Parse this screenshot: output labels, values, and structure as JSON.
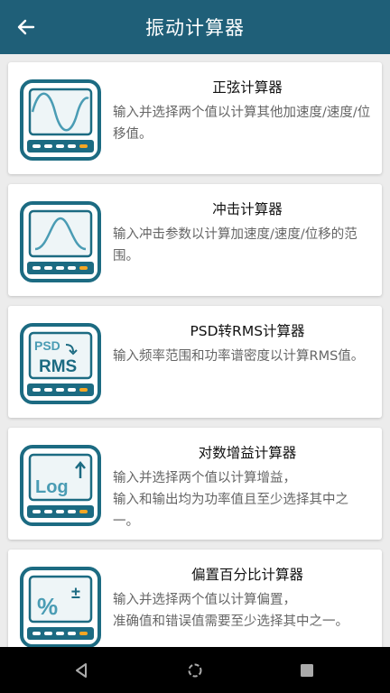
{
  "header": {
    "title": "振动计算器",
    "back_icon": "arrow-left-icon"
  },
  "colors": {
    "appbar": "#1f5f78",
    "accent": "#1c6b82",
    "orange": "#f5a623",
    "background": "#ececec"
  },
  "cards": [
    {
      "title": "正弦计算器",
      "desc": "输入并选择两个值以计算其他加速度/速度/位移值。",
      "icon": "sine-wave-calculator-icon"
    },
    {
      "title": "冲击计算器",
      "desc": "输入冲击参数以计算加速度/速度/位移的范围。",
      "icon": "shock-pulse-calculator-icon"
    },
    {
      "title": "PSD转RMS计算器",
      "desc": "输入频率范围和功率谱密度以计算RMS值。",
      "icon": "psd-rms-calculator-icon",
      "icon_text_1": "PSD",
      "icon_text_2": "RMS"
    },
    {
      "title": "对数增益计算器",
      "desc": "输入并选择两个值以计算增益，\n输入和输出均为功率值且至少选择其中之一。",
      "icon": "log-gain-calculator-icon",
      "icon_text_1": "Log"
    },
    {
      "title": "偏置百分比计算器",
      "desc": "输入并选择两个值以计算偏置，\n准确值和错误值需要至少选择其中之一。",
      "icon": "bias-percent-calculator-icon",
      "icon_text_1": "%",
      "icon_text_2": "±"
    }
  ],
  "navbar": {
    "back": "nav-back-icon",
    "home": "nav-home-icon",
    "recents": "nav-recents-icon"
  }
}
